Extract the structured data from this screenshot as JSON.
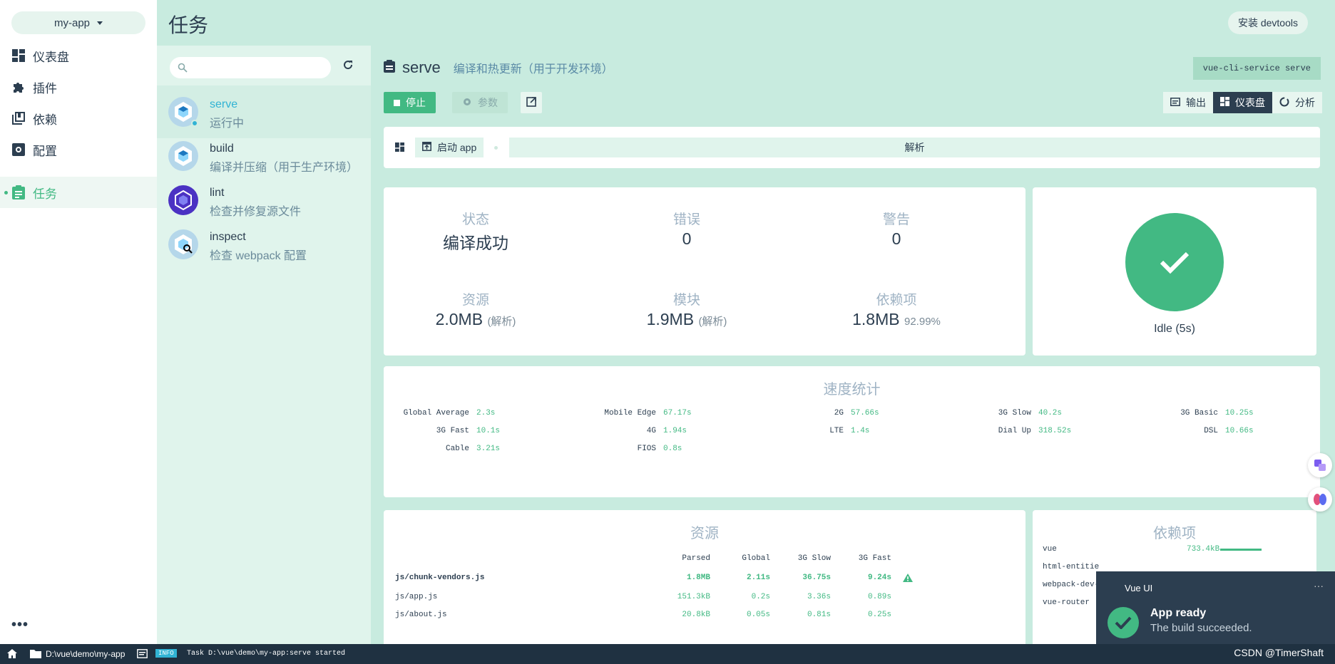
{
  "nav": {
    "project": "my-app",
    "items": [
      {
        "label": "仪表盘",
        "icon": "dashboard-icon"
      },
      {
        "label": "插件",
        "icon": "puzzle-icon"
      },
      {
        "label": "依赖",
        "icon": "library-icon"
      },
      {
        "label": "配置",
        "icon": "settings-icon"
      },
      {
        "label": "任务",
        "icon": "assignment-icon"
      }
    ],
    "active": "任务"
  },
  "header": {
    "title": "任务",
    "install_button": "安装 devtools"
  },
  "tasks": [
    {
      "name": "serve",
      "description": "运行中",
      "status": "running"
    },
    {
      "name": "build",
      "description": "编译并压缩（用于生产环境）"
    },
    {
      "name": "lint",
      "description": "检查并修复源文件"
    },
    {
      "name": "inspect",
      "description": "检查 webpack 配置"
    }
  ],
  "task_detail": {
    "name": "serve",
    "description": "编译和热更新（用于开发环境）",
    "command": "vue-cli-service serve",
    "stop_button": "停止",
    "params_button": "参数",
    "tabs": [
      "输出",
      "仪表盘",
      "分析"
    ],
    "active_tab": "仪表盘"
  },
  "dashboard": {
    "launch_button": "启动 app",
    "analysis_step": "解析",
    "stats": {
      "status_label": "状态",
      "status_value": "编译成功",
      "errors_label": "错误",
      "errors_value": "0",
      "warnings_label": "警告",
      "warnings_value": "0",
      "assets_label": "资源",
      "assets_value": "2.0MB",
      "assets_note": "(解析)",
      "modules_label": "模块",
      "modules_value": "1.9MB",
      "modules_note": "(解析)",
      "deps_label": "依赖项",
      "deps_value": "1.8MB",
      "deps_note": "92.99%"
    },
    "idle": "Idle (5s)",
    "speed": {
      "title": "速度统计",
      "items": [
        {
          "label": "Global Average",
          "value": "2.3s"
        },
        {
          "label": "Mobile Edge",
          "value": "67.17s"
        },
        {
          "label": "2G",
          "value": "57.66s"
        },
        {
          "label": "3G Slow",
          "value": "40.2s"
        },
        {
          "label": "3G Basic",
          "value": "10.25s"
        },
        {
          "label": "3G Fast",
          "value": "10.1s"
        },
        {
          "label": "4G",
          "value": "1.94s"
        },
        {
          "label": "LTE",
          "value": "1.4s"
        },
        {
          "label": "Dial Up",
          "value": "318.52s"
        },
        {
          "label": "DSL",
          "value": "10.66s"
        },
        {
          "label": "Cable",
          "value": "3.21s"
        },
        {
          "label": "FIOS",
          "value": "0.8s"
        }
      ]
    },
    "assets": {
      "title": "资源",
      "headers": [
        "Parsed",
        "Global",
        "3G Slow",
        "3G Fast"
      ],
      "rows": [
        {
          "name": "js/chunk-vendors.js",
          "values": [
            "1.8MB",
            "2.11s",
            "36.75s",
            "9.24s"
          ],
          "warning": true
        },
        {
          "name": "js/app.js",
          "values": [
            "151.3kB",
            "0.2s",
            "3.36s",
            "0.89s"
          ]
        },
        {
          "name": "js/about.js",
          "values": [
            "20.8kB",
            "0.05s",
            "0.81s",
            "0.25s"
          ]
        }
      ]
    },
    "deps": {
      "title": "依赖项",
      "rows": [
        {
          "name": "vue",
          "size": "733.4kB",
          "ratio": 1.0
        },
        {
          "name": "html-entitie"
        },
        {
          "name": "webpack-dev-"
        },
        {
          "name": "vue-router"
        }
      ]
    }
  },
  "toast": {
    "app": "Vue UI",
    "title": "App ready",
    "message": "The build succeeded."
  },
  "footer": {
    "path": "D:\\vue\\demo\\my-app",
    "badge": "INFO",
    "log": "Task D:\\vue\\demo\\my-app:serve started",
    "watermark": "CSDN @TimerShaft"
  },
  "colors": {
    "accent": "#42b983",
    "dark": "#2c3e50",
    "running": "#31b3d4",
    "panel": "#c8ebdf"
  }
}
